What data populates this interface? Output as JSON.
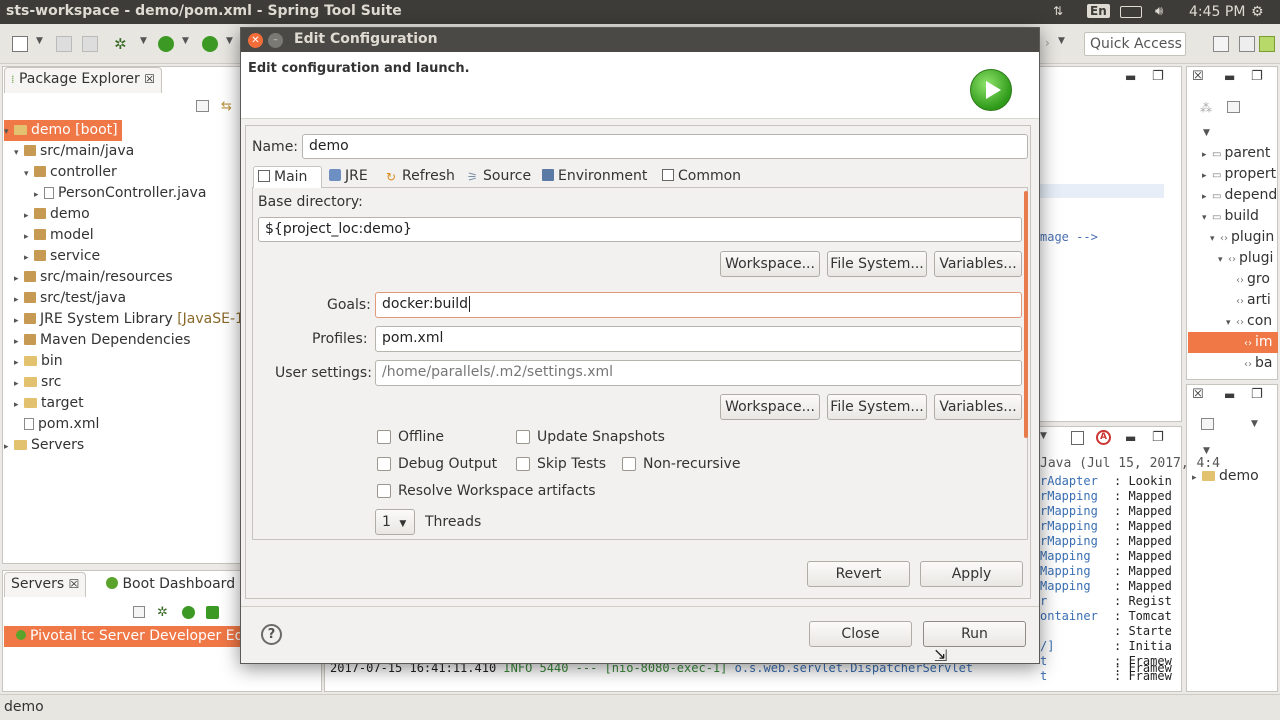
{
  "window": {
    "title": "sts-workspace - demo/pom.xml - Spring Tool Suite",
    "tray_lang": "En",
    "tray_time": "4:45 PM"
  },
  "toolbar": {
    "quick_access": "Quick Access"
  },
  "package_explorer": {
    "tab_label": "Package Explorer",
    "items": [
      {
        "label": "demo [boot]",
        "level": 0,
        "expanded": true,
        "selected": true
      },
      {
        "label": "src/main/java",
        "level": 1,
        "expanded": true
      },
      {
        "label": "controller",
        "level": 2,
        "expanded": true
      },
      {
        "label": "PersonController.java",
        "level": 3,
        "expanded": false
      },
      {
        "label": "demo",
        "level": 2,
        "expanded": false
      },
      {
        "label": "model",
        "level": 2,
        "expanded": false
      },
      {
        "label": "service",
        "level": 2,
        "expanded": false
      },
      {
        "label": "src/main/resources",
        "level": 1,
        "expanded": false
      },
      {
        "label": "src/test/java",
        "level": 1,
        "expanded": false
      },
      {
        "label": "JRE System Library",
        "suffix": "[JavaSE-1",
        "level": 1,
        "expanded": false
      },
      {
        "label": "Maven Dependencies",
        "level": 1,
        "expanded": false
      },
      {
        "label": "bin",
        "level": 1,
        "expanded": false
      },
      {
        "label": "src",
        "level": 1,
        "expanded": false
      },
      {
        "label": "target",
        "level": 1,
        "expanded": false
      },
      {
        "label": "pom.xml",
        "level": 1,
        "expanded": false
      },
      {
        "label": "Servers",
        "level": 0,
        "expanded": false
      }
    ]
  },
  "servers_panel": {
    "tab_servers": "Servers",
    "tab_boot": "Boot Dashboard",
    "server_item": "Pivotal tc Server Developer Edi"
  },
  "outline": {
    "items": [
      "parent",
      "propert",
      "depend",
      "build",
      "plugin",
      "plugi",
      "gro",
      "arti",
      "con",
      "im",
      "ba"
    ]
  },
  "right_bottom": {
    "item": "demo"
  },
  "editor": {
    "snippet": "mage -->"
  },
  "console": {
    "header": "Java (Jul 15, 2017, 4:4",
    "lines_left": [
      "rAdapter",
      "rMapping",
      "rMapping",
      "rMapping",
      "rMapping",
      "Mapping",
      "Mapping",
      "Mapping",
      "r",
      "ontainer",
      "",
      "/]",
      "t",
      "t"
    ],
    "lines_right": [
      ": Lookin",
      ": Mapped",
      ": Mapped",
      ": Mapped",
      ": Mapped",
      ": Mapped",
      ": Mapped",
      ": Mapped",
      ": Regist",
      ": Tomcat",
      ": Starte",
      ": Initia",
      ": Framew",
      ": Framew"
    ],
    "bottom_line_ts": "2017-07-15 16:41:11.410",
    "bottom_line_info": "INFO 5440 --- [nio-8080-exec-1]",
    "bottom_line_class": "o.s.web.servlet.DispatcherServlet"
  },
  "statusbar": {
    "text": "demo"
  },
  "dialog": {
    "title": "Edit Configuration",
    "header": "Edit configuration and launch.",
    "name_label": "Name:",
    "name_value": "demo",
    "tabs": [
      "Main",
      "JRE",
      "Refresh",
      "Source",
      "Environment",
      "Common"
    ],
    "base_dir_label": "Base directory:",
    "base_dir_value": "${project_loc:demo}",
    "workspace_btn": "Workspace...",
    "filesystem_btn": "File System...",
    "variables_btn": "Variables...",
    "goals_label": "Goals:",
    "goals_value": "docker:build",
    "profiles_label": "Profiles:",
    "profiles_value": "pom.xml",
    "user_settings_label": "User settings:",
    "user_settings_value": "/home/parallels/.m2/settings.xml",
    "checkboxes": {
      "offline": "Offline",
      "update_snapshots": "Update Snapshots",
      "debug_output": "Debug Output",
      "skip_tests": "Skip Tests",
      "non_recursive": "Non-recursive",
      "resolve_workspace": "Resolve Workspace artifacts"
    },
    "threads_value": "1",
    "threads_label": "Threads",
    "revert_btn": "Revert",
    "apply_btn": "Apply",
    "close_btn": "Close",
    "run_btn": "Run"
  },
  "colors": {
    "accent": "#f07746",
    "title_bar": "#3d3c38",
    "selection": "#f07746"
  }
}
